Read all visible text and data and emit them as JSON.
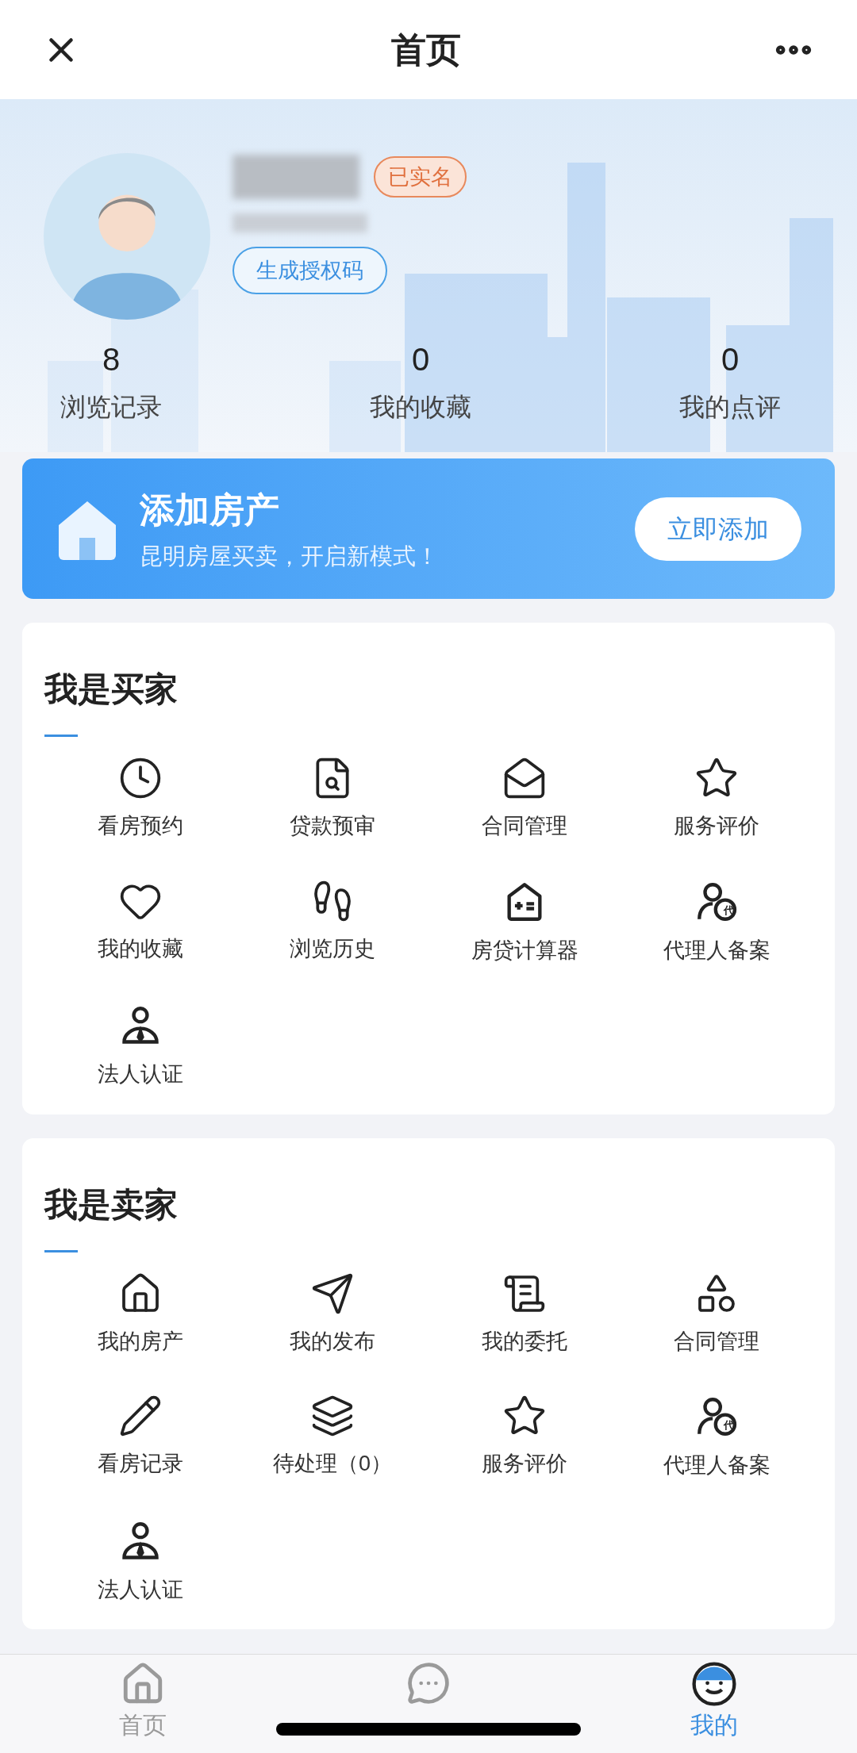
{
  "header": {
    "title": "首页"
  },
  "profile": {
    "verified_badge": "已实名",
    "auth_button": "生成授权码"
  },
  "stats": [
    {
      "value": "8",
      "label": "浏览记录"
    },
    {
      "value": "0",
      "label": "我的收藏"
    },
    {
      "value": "0",
      "label": "我的点评"
    }
  ],
  "banner": {
    "title": "添加房产",
    "subtitle": "昆明房屋买卖，开启新模式！",
    "button": "立即添加"
  },
  "sections": [
    {
      "title": "我是买家",
      "items": [
        {
          "kind": "clock",
          "label": "看房预约"
        },
        {
          "kind": "doc-search",
          "label": "贷款预审"
        },
        {
          "kind": "mail",
          "label": "合同管理"
        },
        {
          "kind": "star",
          "label": "服务评价"
        },
        {
          "kind": "heart",
          "label": "我的收藏"
        },
        {
          "kind": "footprint",
          "label": "浏览历史"
        },
        {
          "kind": "calc-house",
          "label": "房贷计算器"
        },
        {
          "kind": "agent",
          "label": "代理人备案",
          "icon_text": "代"
        },
        {
          "kind": "legal",
          "label": "法人认证"
        }
      ]
    },
    {
      "title": "我是卖家",
      "items": [
        {
          "kind": "house",
          "label": "我的房产"
        },
        {
          "kind": "send",
          "label": "我的发布"
        },
        {
          "kind": "scroll",
          "label": "我的委托"
        },
        {
          "kind": "shapes",
          "label": "合同管理"
        },
        {
          "kind": "pencil",
          "label": "看房记录"
        },
        {
          "kind": "layers",
          "label": "待处理（0）"
        },
        {
          "kind": "star",
          "label": "服务评价"
        },
        {
          "kind": "agent",
          "label": "代理人备案",
          "icon_text": "代"
        },
        {
          "kind": "legal",
          "label": "法人认证"
        }
      ]
    }
  ],
  "tabs": [
    {
      "kind": "home",
      "label": "首页",
      "selected": false
    },
    {
      "kind": "message",
      "selected": false
    },
    {
      "kind": "me",
      "label": "我的",
      "selected": true
    }
  ]
}
